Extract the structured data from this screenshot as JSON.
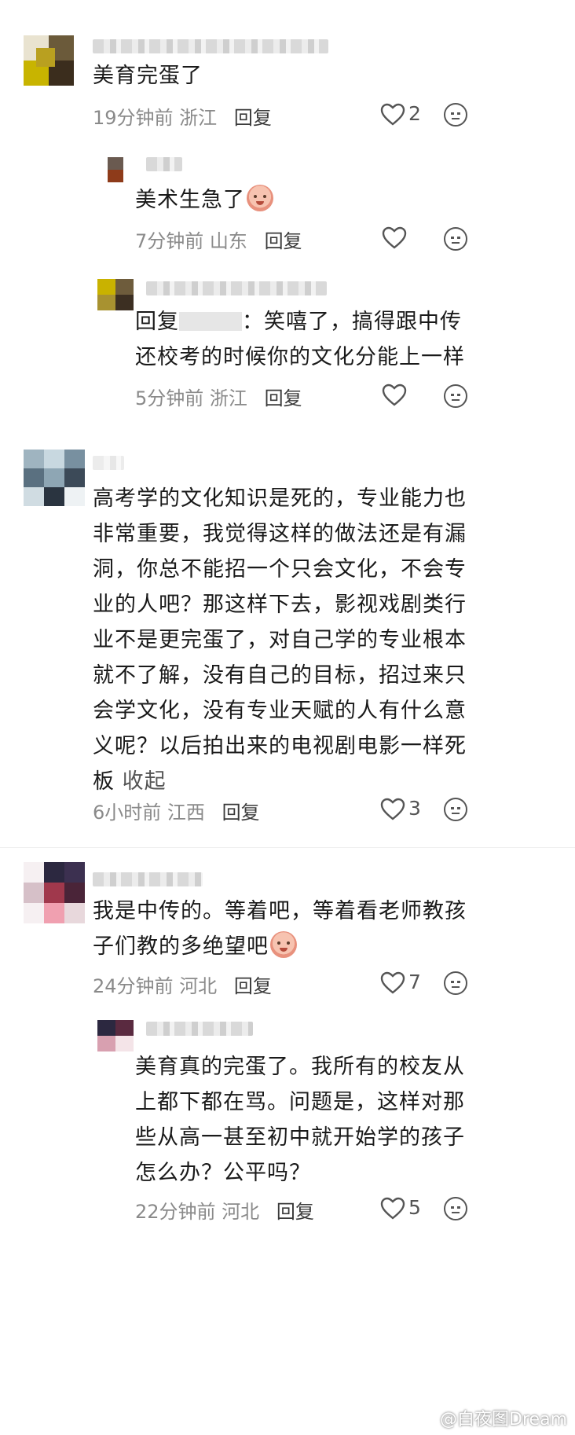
{
  "comments": [
    {
      "text": "美育完蛋了",
      "time": "19分钟前",
      "location": "浙江",
      "reply_label": "回复",
      "likes": "2",
      "replies": [
        {
          "text": "美术生急了",
          "time": "7分钟前",
          "location": "山东",
          "reply_label": "回复",
          "likes": ""
        },
        {
          "reply_prefix": "回复",
          "reply_text_1": "：笑嘻了，搞得跟中传",
          "reply_text_2": "还校考的时候你的文化分能上一样",
          "time": "5分钟前",
          "location": "浙江",
          "reply_label": "回复",
          "likes": ""
        }
      ]
    },
    {
      "lines": [
        "高考学的文化知识是死的，专业能力也",
        "非常重要，我觉得这样的做法还是有漏",
        "洞，你总不能招一个只会文化，不会专",
        "业的人吧？那这样下去，影视戏剧类行",
        "业不是更完蛋了，对自己学的专业根本",
        "就不了解，没有自己的目标，招过来只",
        "会学文化，没有专业天赋的人有什么意",
        "义呢？以后拍出来的电视剧电影一样死"
      ],
      "last_line": "板",
      "collapse_label": "收起",
      "time": "6小时前",
      "location": "江西",
      "reply_label": "回复",
      "likes": "3"
    },
    {
      "line1": "我是中传的。等着吧，等着看老师教孩",
      "line2": "子们教的多绝望吧",
      "time": "24分钟前",
      "location": "河北",
      "reply_label": "回复",
      "likes": "7",
      "replies": [
        {
          "lines": [
            "美育真的完蛋了。我所有的校友从",
            "上都下都在骂。问题是，这样对那",
            "些从高一甚至初中就开始学的孩子",
            "怎么办？公平吗？"
          ],
          "time": "22分钟前",
          "location": "河北",
          "reply_label": "回复",
          "likes": "5"
        }
      ]
    }
  ],
  "watermark": "@白夜图Dream",
  "icons": {
    "like": "heart-outline-icon",
    "emoji": "emoji-face-icon"
  },
  "colors": {
    "text": "#1a1a1a",
    "meta": "#8a8a8a",
    "reply": "#3a3a3a"
  }
}
